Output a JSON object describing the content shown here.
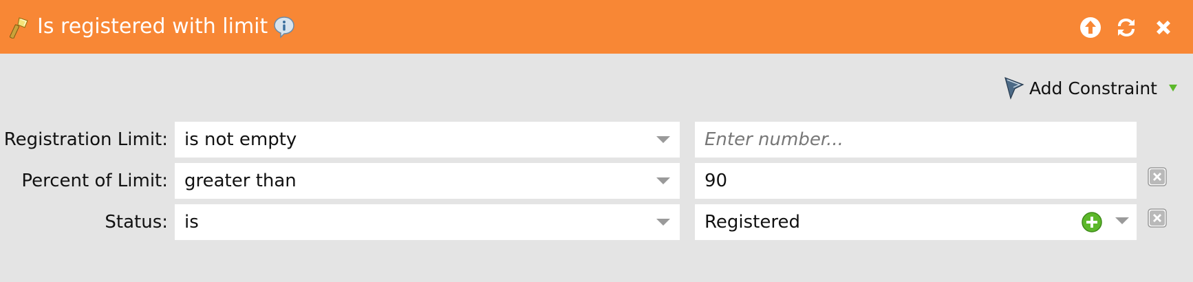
{
  "dialog": {
    "title": "Is registered with limit"
  },
  "toolbar": {
    "add_constraint_label": "Add Constraint"
  },
  "rows": [
    {
      "label": "Registration Limit:",
      "operator": "is not empty",
      "value": "",
      "placeholder": "Enter number..."
    },
    {
      "label": "Percent of Limit:",
      "operator": "greater than",
      "value": "90"
    },
    {
      "label": "Status:",
      "operator": "is",
      "value": "Registered"
    }
  ],
  "colors": {
    "header": "#f88735",
    "panel": "#e4e4e4",
    "input_bg": "#ffffff",
    "add_green": "#5cb82a"
  },
  "icons": {
    "header": "filter-wand-icon",
    "info": "info-icon",
    "up": "arrow-up-circle-icon",
    "refresh": "refresh-icon",
    "close": "close-icon",
    "constraint": "funnel-icon",
    "add_value": "plus-circle-icon",
    "remove_row": "remove-square-icon"
  }
}
